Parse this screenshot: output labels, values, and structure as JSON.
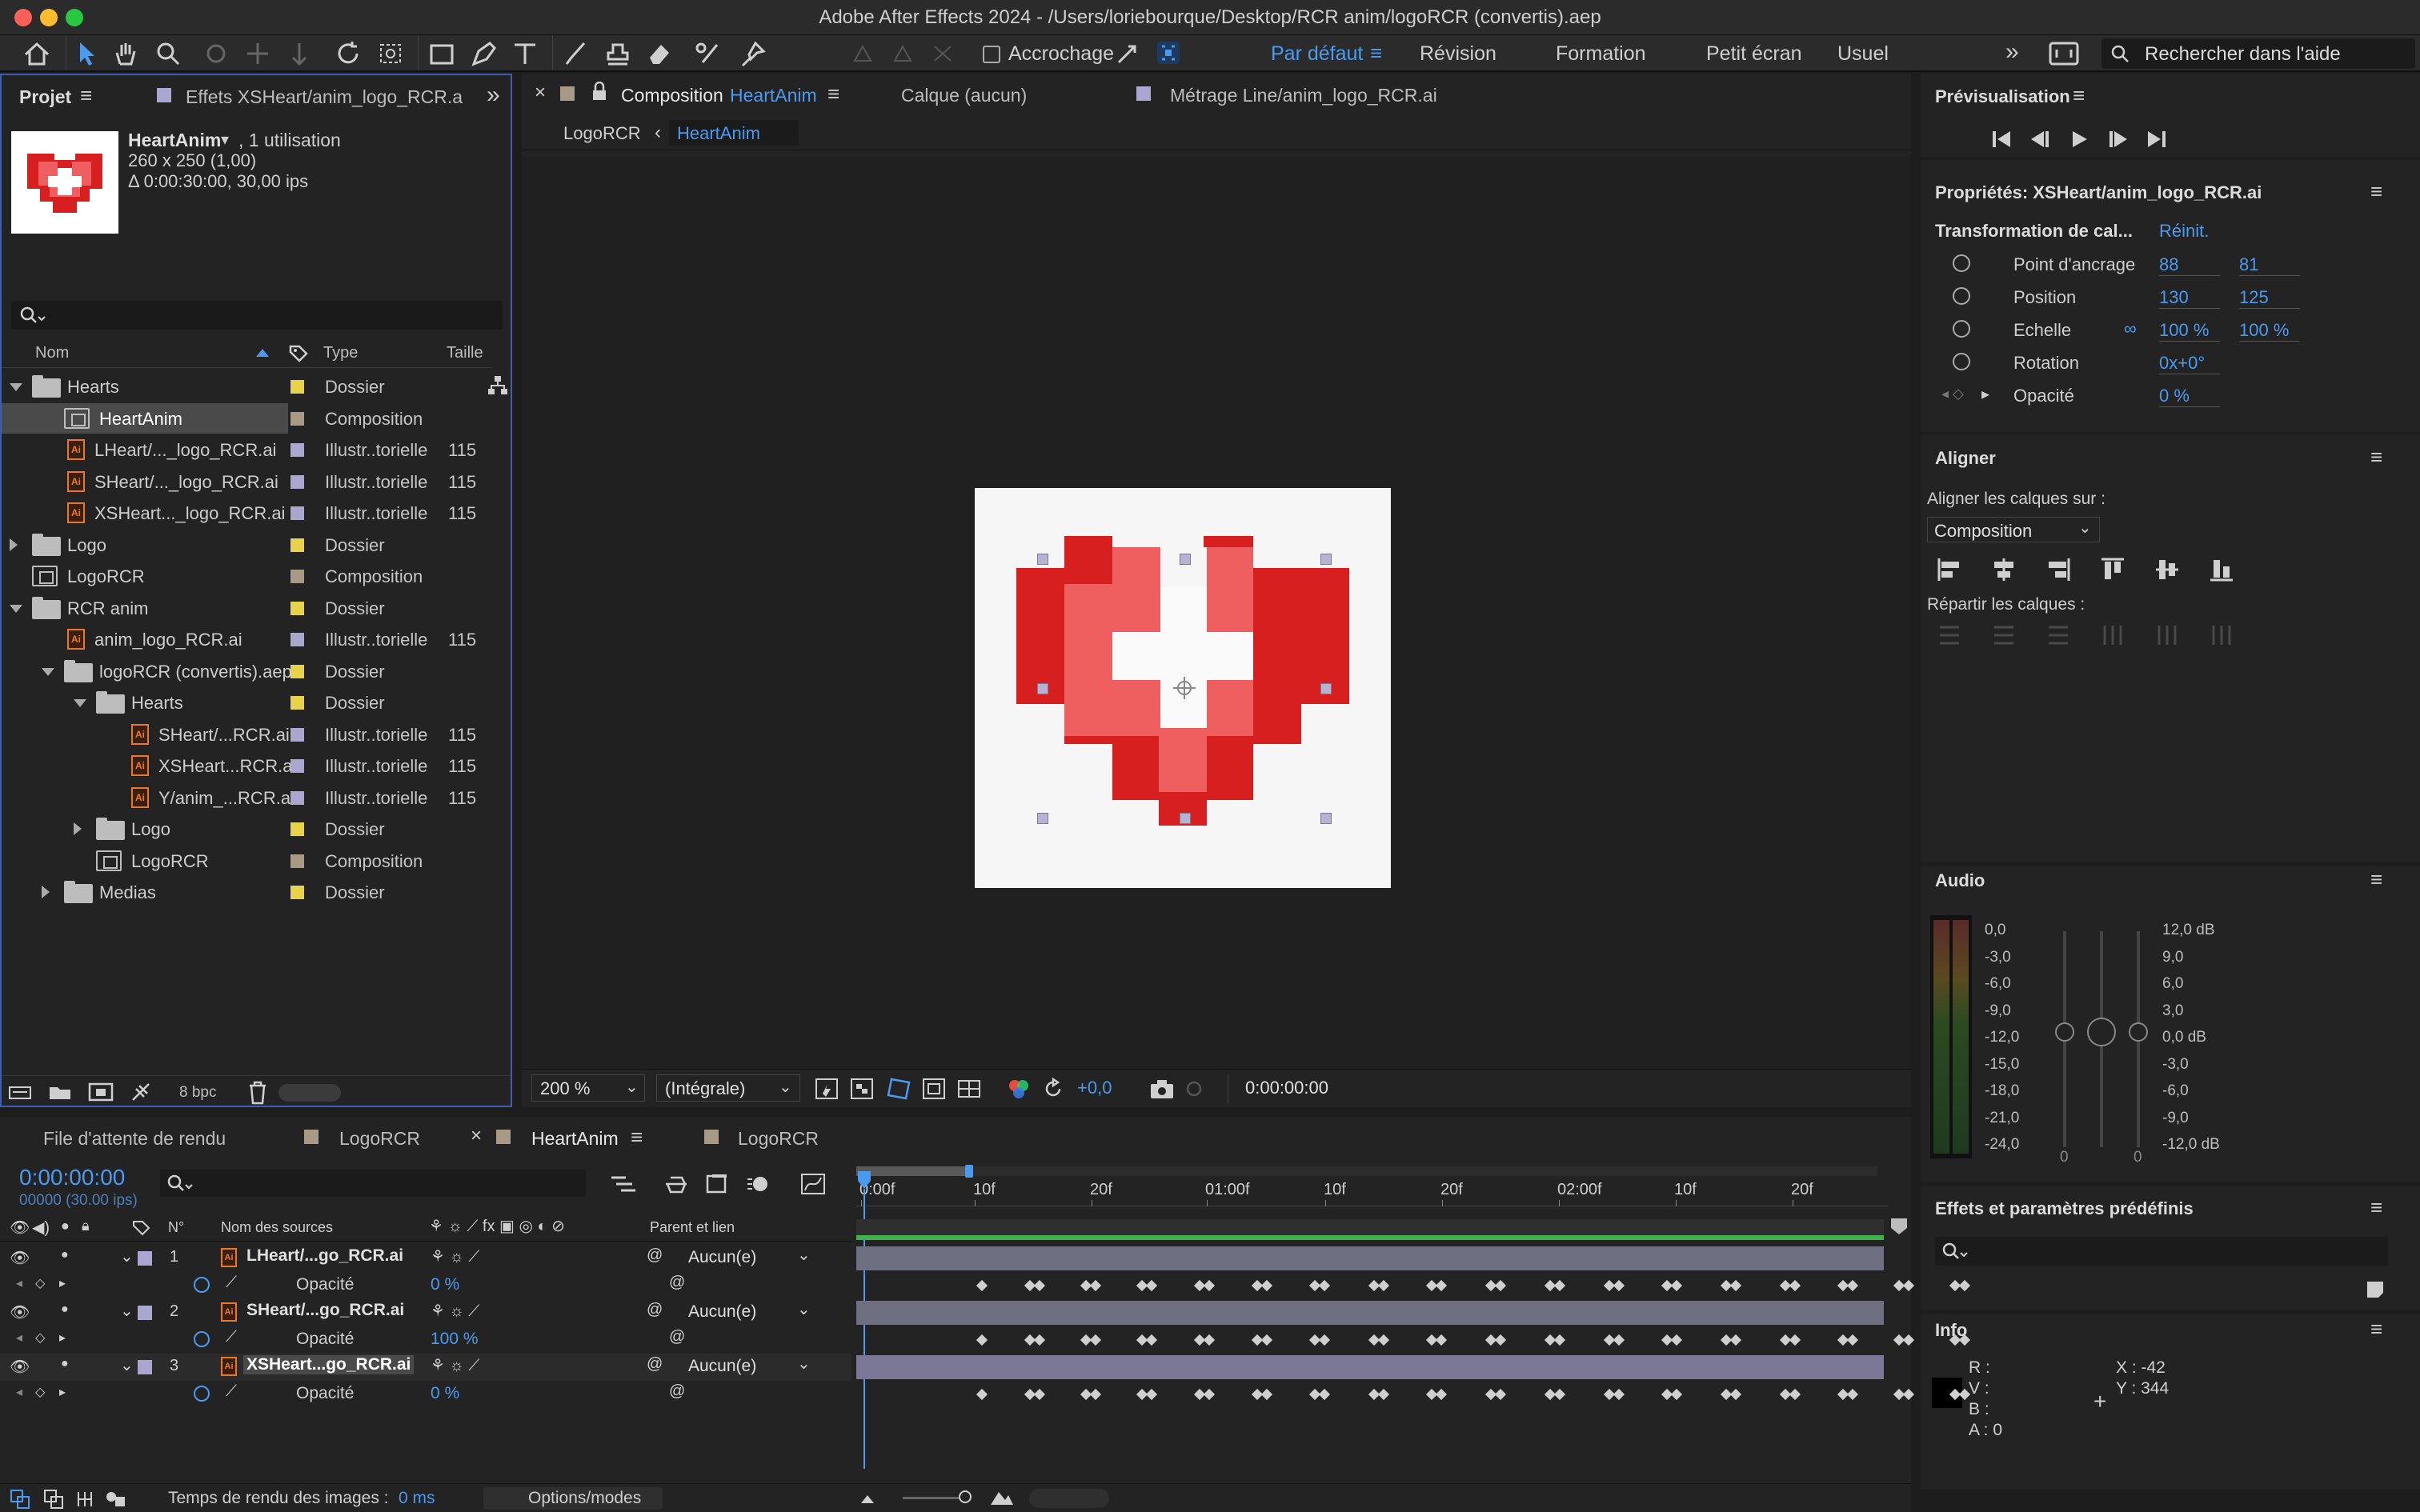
{
  "window": {
    "title": "Adobe After Effects 2024 - /Users/loriebourque/Desktop/RCR anim/logoRCR (convertis).aep"
  },
  "toolbar": {
    "snapping_label": "Accrochage",
    "workspaces": [
      "Par défaut",
      "Révision",
      "Formation",
      "Petit écran",
      "Usuel"
    ],
    "search_placeholder": "Rechercher dans l'aide"
  },
  "project": {
    "tab_label": "Projet",
    "effects_tab": "Effets XSHeart/anim_logo_RCR.a",
    "selected_name": "HeartAnim",
    "selected_usage": ", 1 utilisation",
    "selected_dims": "260 x 250 (1,00)",
    "selected_duration": "Δ 0:00:30:00, 30,00 ips",
    "columns": {
      "name": "Nom",
      "type": "Type",
      "size": "Taille"
    },
    "items": [
      {
        "name": "Hearts",
        "type": "Dossier",
        "size": "",
        "kind": "folder",
        "indent": 0,
        "expander": "open",
        "label": "#e7d24a"
      },
      {
        "name": "HeartAnim",
        "type": "Composition",
        "size": "",
        "kind": "comp",
        "indent": 1,
        "expander": "none",
        "label": "#a89a86",
        "selected": true
      },
      {
        "name": "LHeart/..._logo_RCR.ai",
        "type": "Illustr..torielle",
        "size": "115",
        "kind": "ai",
        "indent": 1,
        "expander": "none",
        "label": "#a9a6cf"
      },
      {
        "name": "SHeart/..._logo_RCR.ai",
        "type": "Illustr..torielle",
        "size": "115",
        "kind": "ai",
        "indent": 1,
        "expander": "none",
        "label": "#a9a6cf"
      },
      {
        "name": "XSHeart..._logo_RCR.ai",
        "type": "Illustr..torielle",
        "size": "115",
        "kind": "ai",
        "indent": 1,
        "expander": "none",
        "label": "#a9a6cf"
      },
      {
        "name": "Logo",
        "type": "Dossier",
        "size": "",
        "kind": "folder",
        "indent": 0,
        "expander": "closed",
        "label": "#e7d24a"
      },
      {
        "name": "LogoRCR",
        "type": "Composition",
        "size": "",
        "kind": "comp",
        "indent": 0,
        "expander": "none",
        "label": "#a89a86"
      },
      {
        "name": "RCR anim",
        "type": "Dossier",
        "size": "",
        "kind": "folder",
        "indent": 0,
        "expander": "open",
        "label": "#e7d24a"
      },
      {
        "name": "anim_logo_RCR.ai",
        "type": "Illustr..torielle",
        "size": "115",
        "kind": "ai",
        "indent": 1,
        "expander": "none",
        "label": "#a9a6cf"
      },
      {
        "name": "logoRCR (convertis).aep",
        "type": "Dossier",
        "size": "",
        "kind": "folder",
        "indent": 1,
        "expander": "open",
        "label": "#e7d24a"
      },
      {
        "name": "Hearts",
        "type": "Dossier",
        "size": "",
        "kind": "folder",
        "indent": 2,
        "expander": "open",
        "label": "#e7d24a"
      },
      {
        "name": "SHeart/...RCR.ai",
        "type": "Illustr..torielle",
        "size": "115",
        "kind": "ai",
        "indent": 3,
        "expander": "none",
        "label": "#a9a6cf"
      },
      {
        "name": "XSHeart...RCR.ai",
        "type": "Illustr..torielle",
        "size": "115",
        "kind": "ai",
        "indent": 3,
        "expander": "none",
        "label": "#a9a6cf"
      },
      {
        "name": "Y/anim_...RCR.ai",
        "type": "Illustr..torielle",
        "size": "115",
        "kind": "ai",
        "indent": 3,
        "expander": "none",
        "label": "#a9a6cf"
      },
      {
        "name": "Logo",
        "type": "Dossier",
        "size": "",
        "kind": "folder",
        "indent": 2,
        "expander": "closed",
        "label": "#e7d24a"
      },
      {
        "name": "LogoRCR",
        "type": "Composition",
        "size": "",
        "kind": "comp",
        "indent": 2,
        "expander": "none",
        "label": "#a89a86"
      },
      {
        "name": "Medias",
        "type": "Dossier",
        "size": "",
        "kind": "folder",
        "indent": 1,
        "expander": "closed",
        "label": "#e7d24a"
      }
    ],
    "bpc": "8 bpc"
  },
  "viewer": {
    "comp_tab_prefix": "Composition",
    "comp_tab_name": "HeartAnim",
    "layer_tab": "Calque  (aucun)",
    "footage_tab": "Métrage  Line/anim_logo_RCR.ai",
    "breadcrumb": [
      "LogoRCR",
      "HeartAnim"
    ],
    "zoom": "200 %",
    "resolution": "(Intégrale)",
    "exposure": "+0,0",
    "timecode": "0:00:00:00"
  },
  "preview": {
    "title": "Prévisualisation"
  },
  "properties": {
    "title": "Propriétés: XSHeart/anim_logo_RCR.ai",
    "group": "Transformation de cal...",
    "reset": "Réinit.",
    "rows": [
      {
        "label": "Point d'ancrage",
        "v1": "88",
        "v2": "81"
      },
      {
        "label": "Position",
        "v1": "130",
        "v2": "125"
      },
      {
        "label": "Echelle",
        "v1": "100 %",
        "v2": "100 %"
      },
      {
        "label": "Rotation",
        "v1": "0x+0°",
        "v2": ""
      },
      {
        "label": "Opacité",
        "v1": "0 %",
        "v2": ""
      }
    ]
  },
  "align": {
    "title": "Aligner",
    "align_to_label": "Aligner les calques sur :",
    "align_to_value": "Composition",
    "distribute_label": "Répartir les calques :"
  },
  "audio": {
    "title": "Audio",
    "left_scale": [
      "0,0",
      "-3,0",
      "-6,0",
      "-9,0",
      "-12,0",
      "-15,0",
      "-18,0",
      "-21,0",
      "-24,0"
    ],
    "right_scale": [
      "12,0 dB",
      "9,0",
      "6,0",
      "3,0",
      "0,0 dB",
      "-3,0",
      "-6,0",
      "-9,0",
      "-12,0 dB"
    ],
    "slider_zero_left": "0",
    "slider_zero_right": "0"
  },
  "effects_presets": {
    "title": "Effets et paramètres prédéfinis"
  },
  "info": {
    "title": "Info",
    "r": "R :",
    "v": "V :",
    "b": "B :",
    "a": "A : 0",
    "x": "X : -42",
    "y": "Y : 344"
  },
  "timeline": {
    "tabs": [
      "File d'attente de rendu",
      "LogoRCR",
      "HeartAnim",
      "LogoRCR"
    ],
    "current_time": "0:00:00:00",
    "current_frame": "00000 (30.00 ips)",
    "ruler": [
      "0:00f",
      "10f",
      "20f",
      "01:00f",
      "10f",
      "20f",
      "02:00f",
      "10f",
      "20f"
    ],
    "col_num": "N°",
    "col_source": "Nom des sources",
    "col_parent": "Parent et lien",
    "layers": [
      {
        "num": "1",
        "name": "LHeart/...go_RCR.ai",
        "parent": "Aucun(e)",
        "prop": "Opacité",
        "value": "0 %"
      },
      {
        "num": "2",
        "name": "SHeart/...go_RCR.ai",
        "parent": "Aucun(e)",
        "prop": "Opacité",
        "value": "100 %"
      },
      {
        "num": "3",
        "name": "XSHeart...go_RCR.ai",
        "parent": "Aucun(e)",
        "prop": "Opacité",
        "value": "0 %"
      }
    ],
    "render_time_label": "Temps de rendu des images : ",
    "render_time_value": "0 ms",
    "options_modes": "Options/modes"
  },
  "colors": {
    "accent": "#4a9bf0",
    "heart_dark": "#d81f1f",
    "heart_light": "#ef5f5f",
    "layer_label": "#a9a6cf",
    "folder_label": "#e7d24a"
  }
}
